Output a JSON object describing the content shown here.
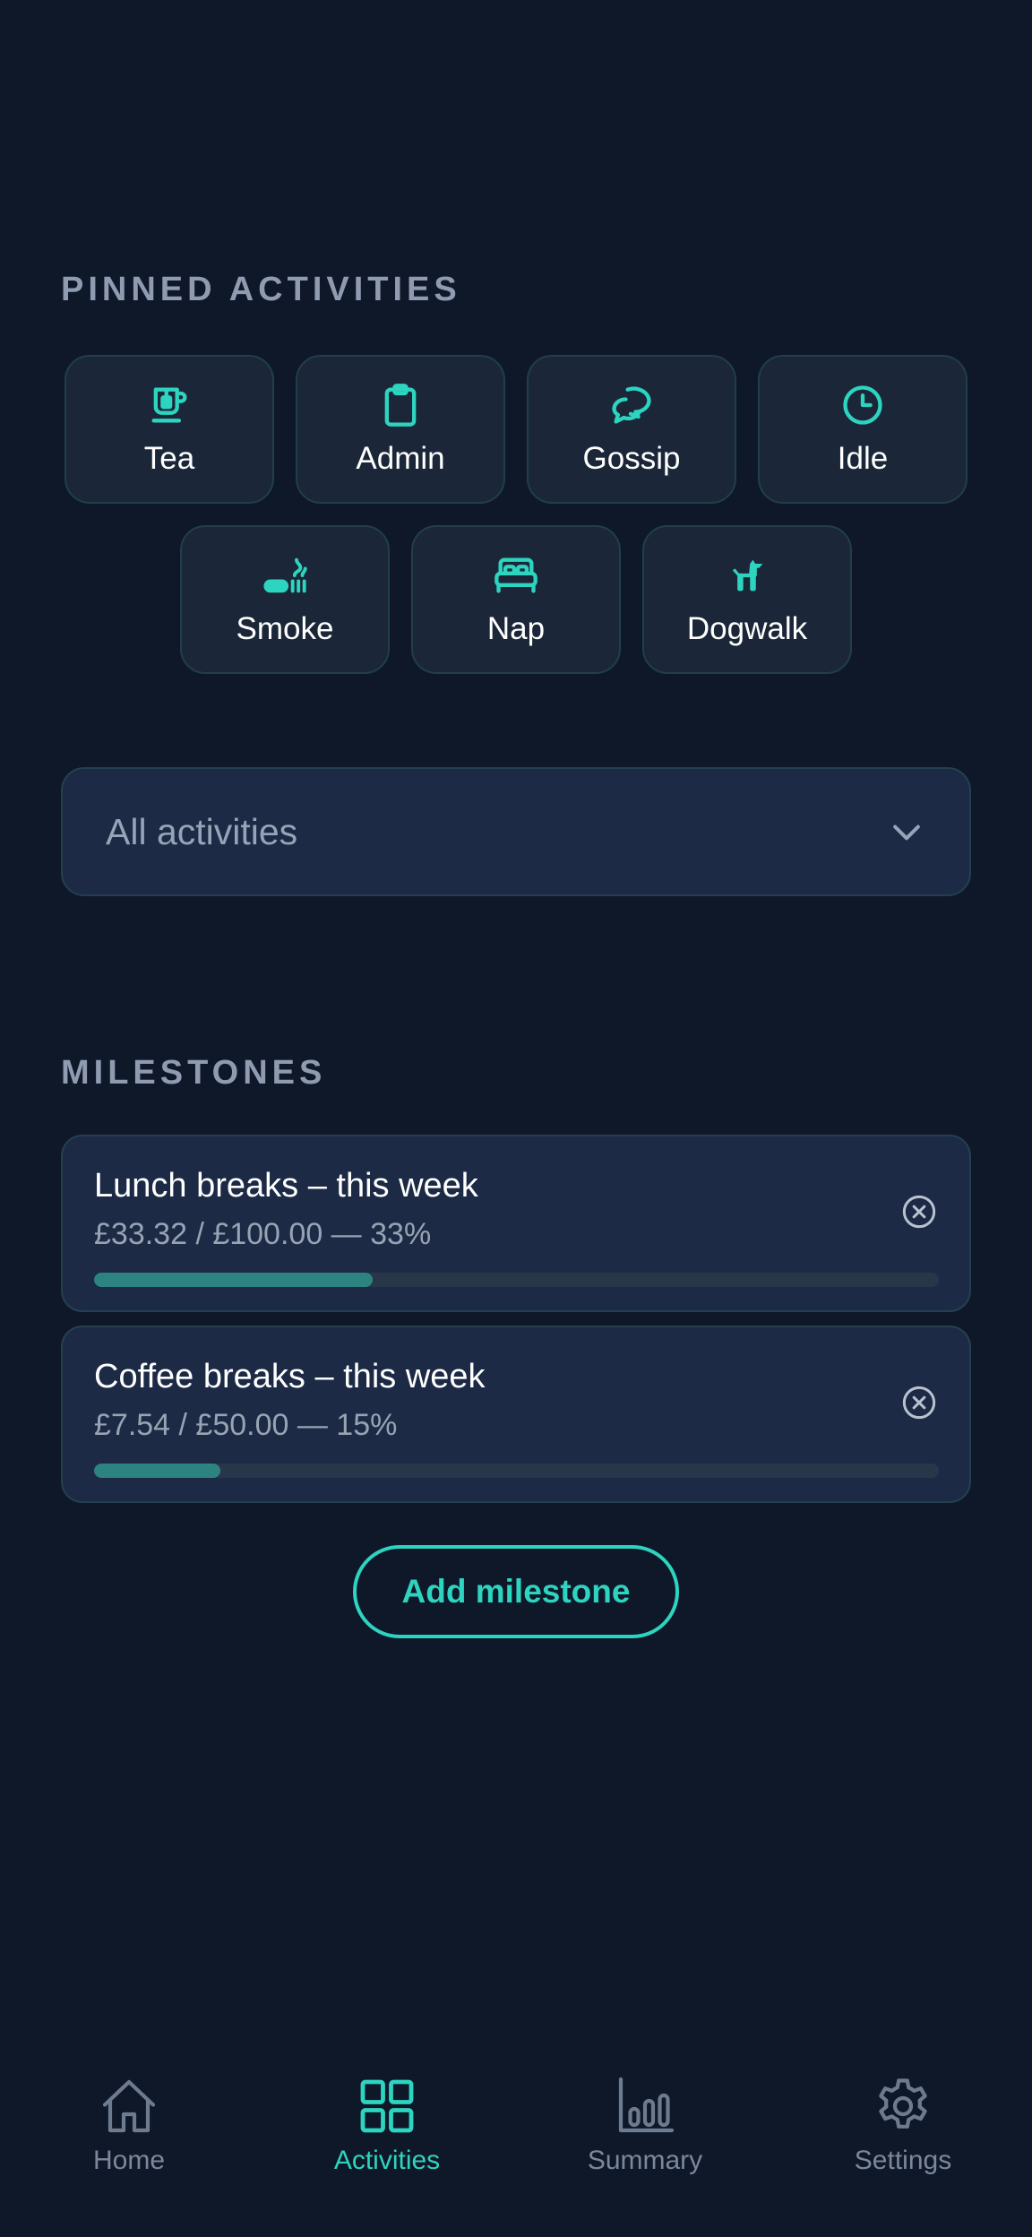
{
  "pinned": {
    "title": "PINNED ACTIVITIES",
    "items": [
      {
        "label": "Tea",
        "icon": "tea-icon"
      },
      {
        "label": "Admin",
        "icon": "clipboard-icon"
      },
      {
        "label": "Gossip",
        "icon": "chat-bubbles-icon"
      },
      {
        "label": "Idle",
        "icon": "clock-icon"
      },
      {
        "label": "Smoke",
        "icon": "smoking-icon"
      },
      {
        "label": "Nap",
        "icon": "bed-icon"
      },
      {
        "label": "Dogwalk",
        "icon": "dog-icon"
      }
    ]
  },
  "filter": {
    "value": "All activities",
    "icon": "chevron-down-icon"
  },
  "milestones": {
    "title": "MILESTONES",
    "items": [
      {
        "title": "Lunch breaks – this week",
        "progress_text": "£33.32 / £100.00 — 33%",
        "progress": 0.33
      },
      {
        "title": "Coffee breaks – this week",
        "progress_text": "£7.54 / £50.00 — 15%",
        "progress": 0.15
      }
    ],
    "add_label": "Add milestone"
  },
  "nav": {
    "items": [
      {
        "label": "Home",
        "icon": "home-icon",
        "active": false
      },
      {
        "label": "Activities",
        "icon": "grid-icon",
        "active": true
      },
      {
        "label": "Summary",
        "icon": "bar-chart-icon",
        "active": false
      },
      {
        "label": "Settings",
        "icon": "gear-icon",
        "active": false
      }
    ]
  },
  "colors": {
    "background": "#0f1829",
    "accent": "#2dd4bf",
    "card": "#1b2738",
    "progress": "#2d837f"
  }
}
